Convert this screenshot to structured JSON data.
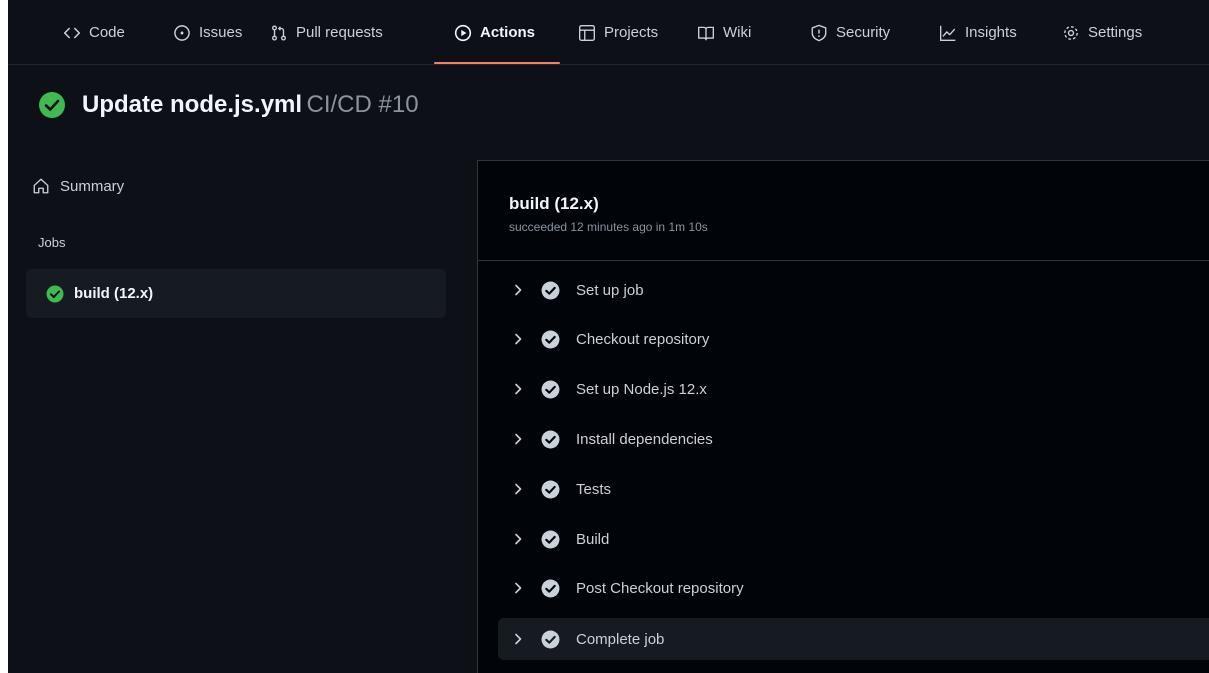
{
  "nav": {
    "tabs": [
      {
        "label": "Code",
        "icon": "code-icon"
      },
      {
        "label": "Issues",
        "icon": "issue-opened-icon"
      },
      {
        "label": "Pull requests",
        "icon": "git-pull-request-icon"
      },
      {
        "label": "Actions",
        "icon": "play-icon"
      },
      {
        "label": "Projects",
        "icon": "table-icon"
      },
      {
        "label": "Wiki",
        "icon": "book-icon"
      },
      {
        "label": "Security",
        "icon": "shield-icon"
      },
      {
        "label": "Insights",
        "icon": "graph-icon"
      },
      {
        "label": "Settings",
        "icon": "gear-icon"
      }
    ],
    "active_tab": "Actions"
  },
  "run": {
    "title": "Update node.js.yml",
    "workflow": "CI/CD #10",
    "status": "success"
  },
  "sidebar": {
    "summary_label": "Summary",
    "jobs_heading": "Jobs",
    "jobs": [
      {
        "label": "build (12.x)",
        "status": "success"
      }
    ]
  },
  "job": {
    "title": "build (12.x)",
    "meta": "succeeded 12 minutes ago in 1m 10s",
    "steps": [
      {
        "label": "Set up job"
      },
      {
        "label": "Checkout repository"
      },
      {
        "label": "Set up Node.js 12.x"
      },
      {
        "label": "Install dependencies"
      },
      {
        "label": "Tests"
      },
      {
        "label": "Build"
      },
      {
        "label": "Post Checkout repository"
      },
      {
        "label": "Complete job"
      }
    ]
  },
  "colors": {
    "background": "#0d1117",
    "panel": "#010409",
    "success": "#3fb950",
    "active_underline": "#f78166",
    "muted_text": "#8b949e"
  }
}
